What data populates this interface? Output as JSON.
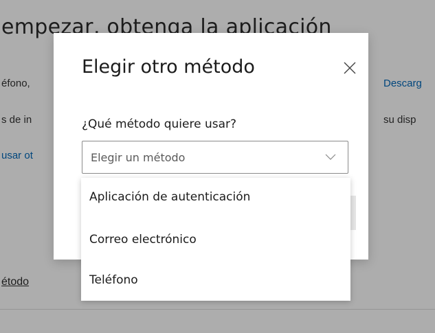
{
  "background": {
    "heading": "empezar, obtenga la aplicación",
    "line1_left": "éfono,",
    "line1_right": "Descarg",
    "line2_left": "s de in",
    "line2_right": "su disp",
    "line3_left": "usar ot",
    "bottom_link": "étodo"
  },
  "dialog": {
    "title": "Elegir otro método",
    "close_icon": "close-icon",
    "field_label": "¿Qué método quiere usar?",
    "select": {
      "placeholder": "Elegir un método",
      "icon": "chevron-down-icon"
    },
    "options": [
      {
        "label": "Aplicación de autenticación"
      },
      {
        "label": "Correo electrónico"
      },
      {
        "label": "Teléfono"
      }
    ]
  },
  "colors": {
    "link": "#0067b8",
    "overlay": "#000000",
    "text": "#1b1b1b"
  }
}
